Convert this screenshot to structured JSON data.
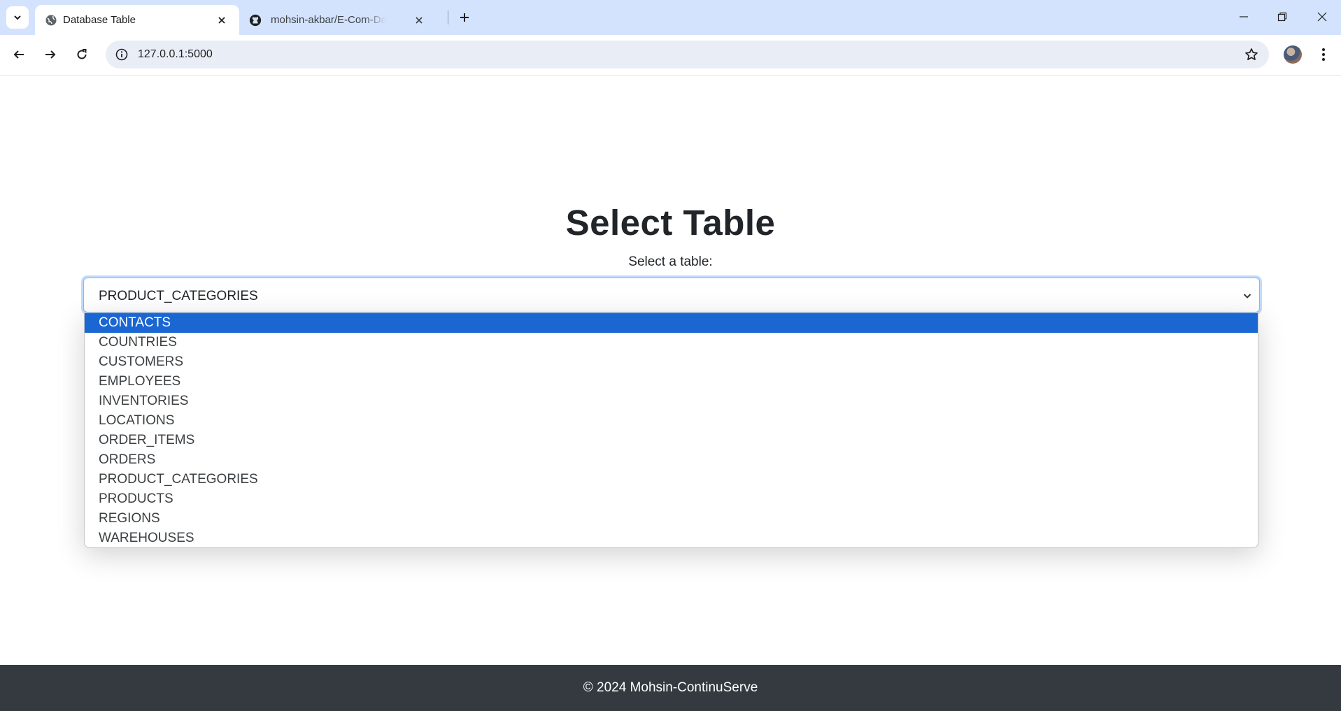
{
  "browser": {
    "tabs": [
      {
        "title": "Database Table",
        "active": true
      },
      {
        "title": "mohsin-akbar/E-Com-Data-handling",
        "active": false
      }
    ],
    "address": "127.0.0.1:5000"
  },
  "page": {
    "heading": "Select Table",
    "select_label": "Select a table:",
    "select_value": "PRODUCT_CATEGORIES",
    "options": [
      "CONTACTS",
      "COUNTRIES",
      "CUSTOMERS",
      "EMPLOYEES",
      "INVENTORIES",
      "LOCATIONS",
      "ORDER_ITEMS",
      "ORDERS",
      "PRODUCT_CATEGORIES",
      "PRODUCTS",
      "REGIONS",
      "WAREHOUSES"
    ],
    "highlighted_option": "CONTACTS"
  },
  "footer": {
    "text": "© 2024 Mohsin-ContinuServe"
  },
  "colors": {
    "tabstrip": "#d3e3fd",
    "highlight": "#1a66d2",
    "footer": "#343a40",
    "heading": "#212529"
  }
}
